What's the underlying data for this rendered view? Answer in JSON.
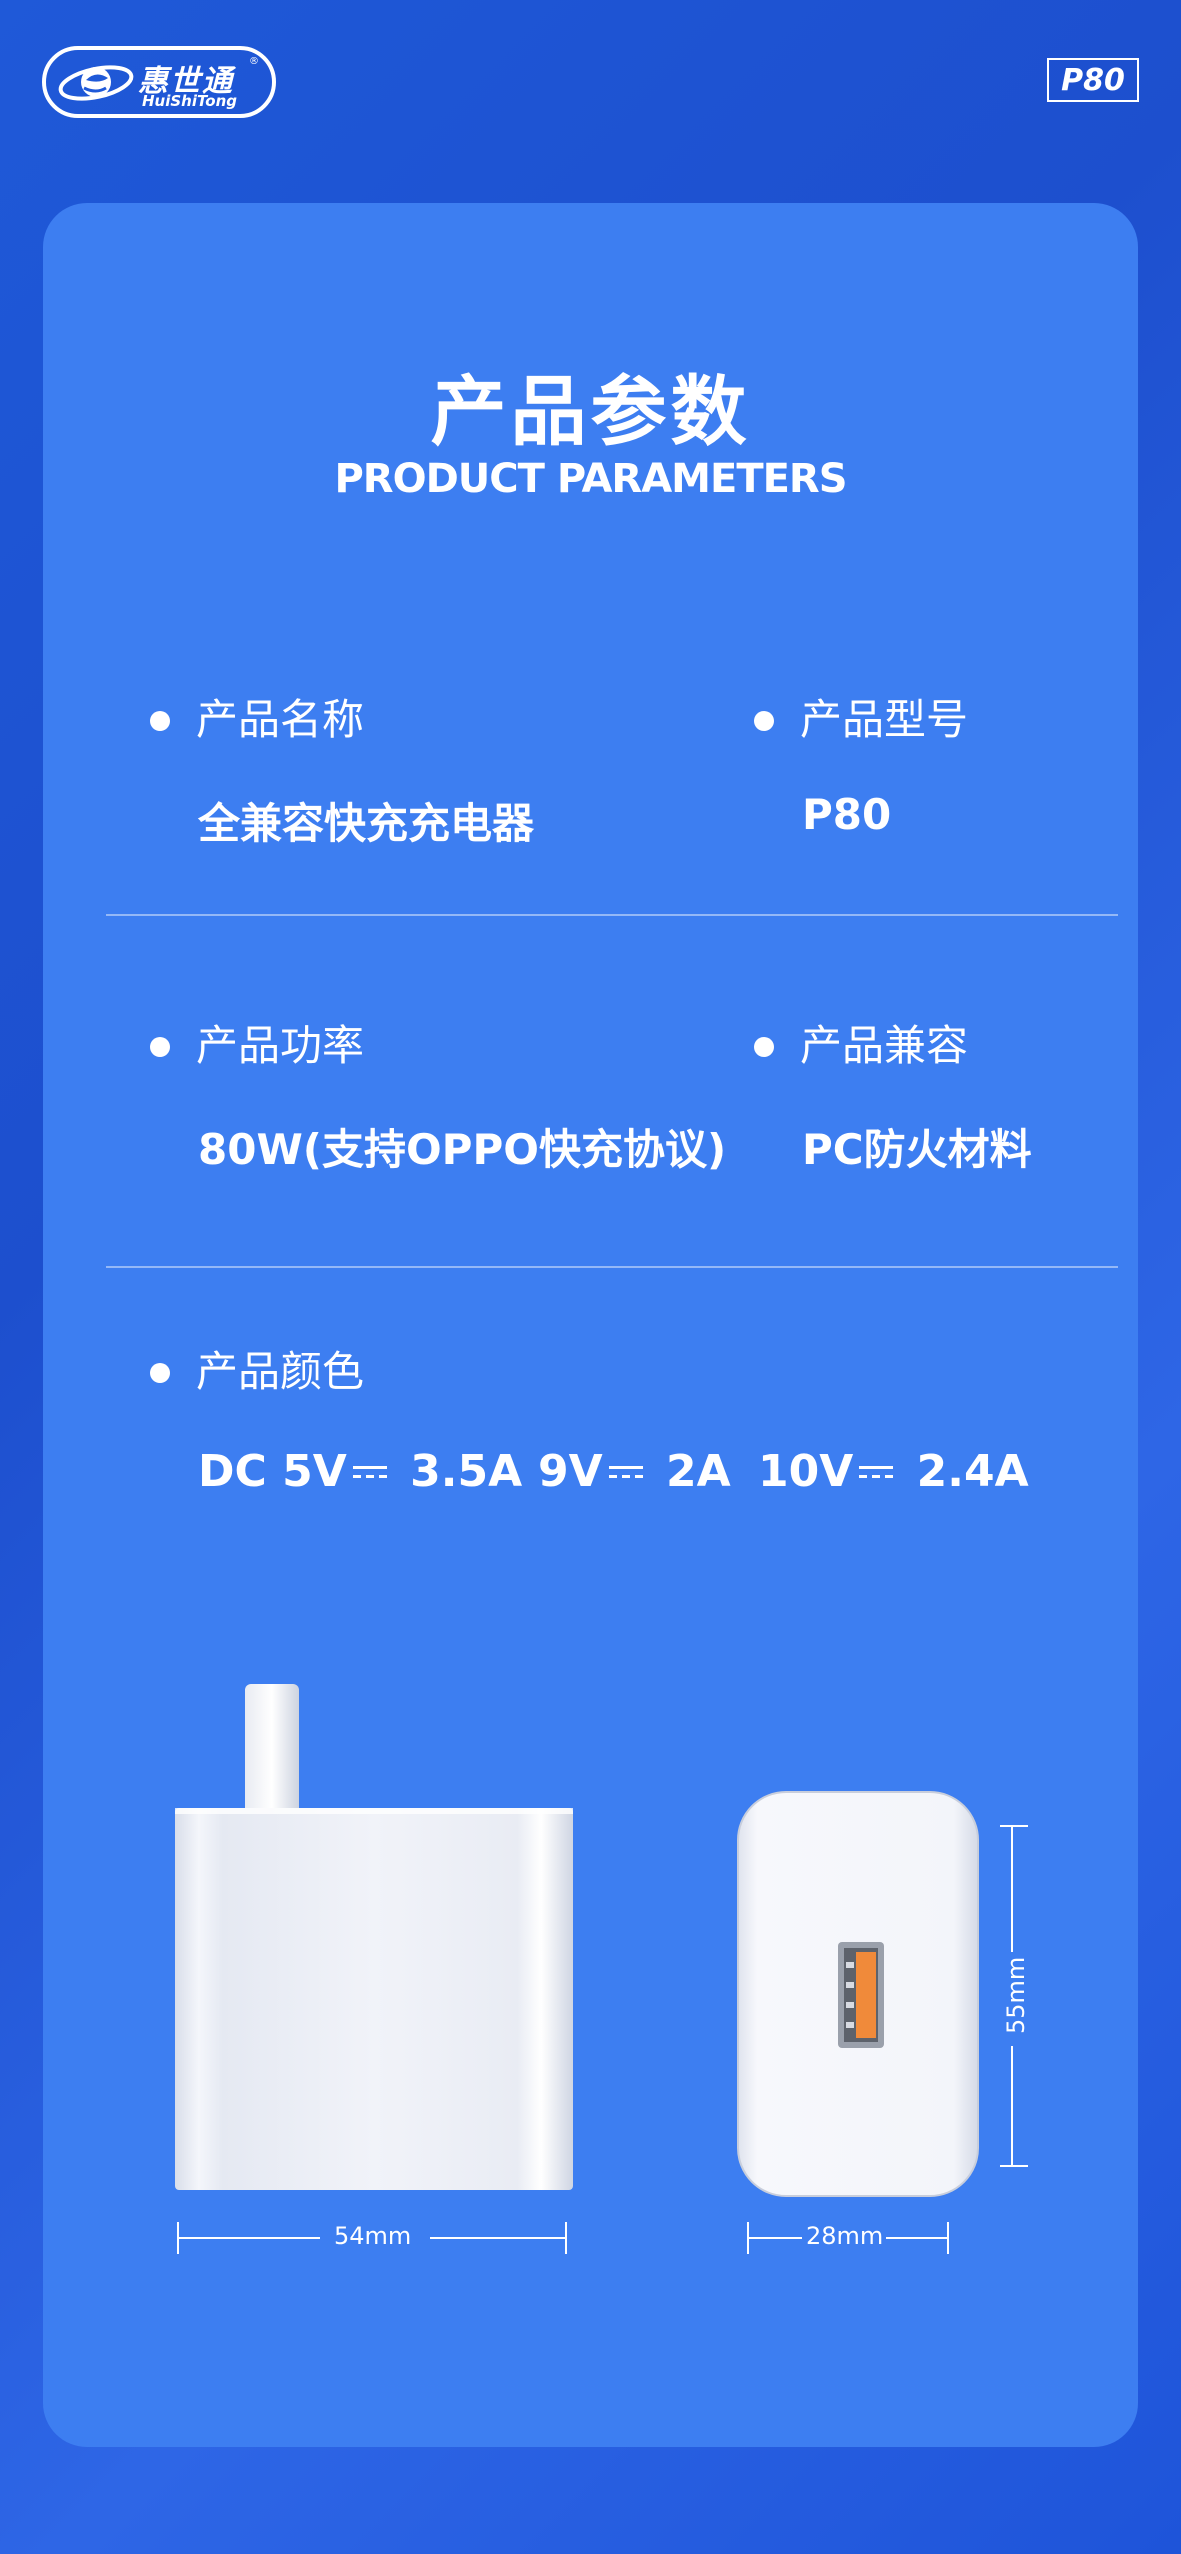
{
  "brand": {
    "name_cn": "惠世通",
    "name_en": "HuiShiTong",
    "reg_mark": "®"
  },
  "model_badge": "P80",
  "title": {
    "cn": "产品参数",
    "en": "PRODUCT PARAMETERS"
  },
  "params": [
    {
      "label": "产品名称",
      "value": "全兼容快充充电器"
    },
    {
      "label": "产品型号",
      "value": "P80"
    },
    {
      "label": "产品功率",
      "value": "80W(支持OPPO快充协议)"
    },
    {
      "label": "产品兼容",
      "value": "PC防火材料"
    },
    {
      "label": "产品颜色"
    }
  ],
  "specs": {
    "prefix": "DC",
    "items": [
      {
        "voltage": "5V",
        "current": "3.5A"
      },
      {
        "voltage": "9V",
        "current": "2A"
      },
      {
        "voltage": "10V",
        "current": "2.4A"
      }
    ]
  },
  "dimensions": {
    "width": "54mm",
    "depth": "28mm",
    "height": "55mm"
  },
  "colors": {
    "background": "#1f59d8",
    "card": "#3d7ef1",
    "port": "#f08a3a"
  }
}
